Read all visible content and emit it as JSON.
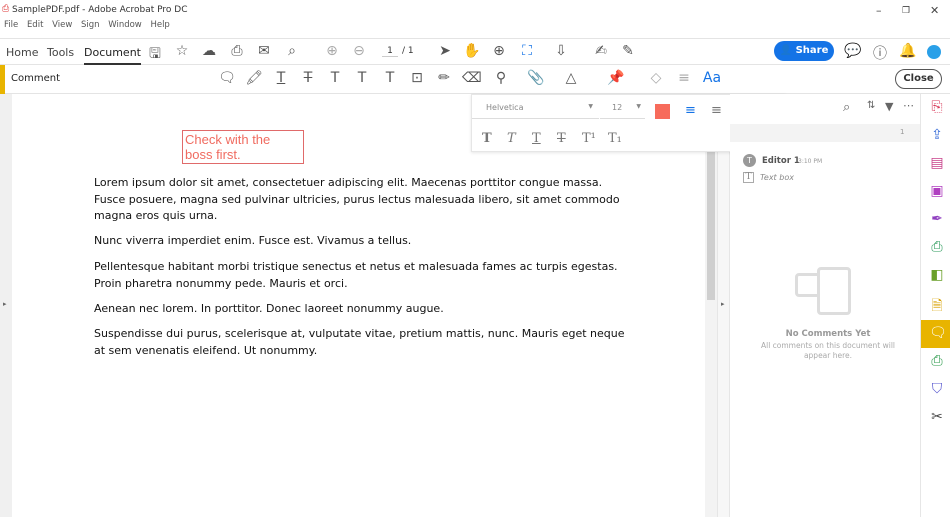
{
  "window": {
    "title": "SamplePDF.pdf - Adobe Acrobat Pro DC"
  },
  "menu": [
    "File",
    "Edit",
    "View",
    "Sign",
    "Window",
    "Help"
  ],
  "toolbar": {
    "tabs": [
      "Home",
      "Tools",
      "Document"
    ],
    "active_tab": "Document",
    "page_current": "1",
    "page_total": "/ 1",
    "share_label": "Share"
  },
  "comment_bar": {
    "label": "Comment",
    "close_label": "Close",
    "aa_label": "Aa"
  },
  "format_popup": {
    "font": "Helvetica",
    "size": "12",
    "color": "#f76b5b"
  },
  "document": {
    "textbox": "Check with the boss first.",
    "paragraphs": [
      "Lorem ipsum dolor sit amet, consectetuer adipiscing elit. Maecenas porttitor congue massa. Fusce posuere, magna sed pulvinar ultricies, purus lectus malesuada libero, sit amet commodo magna eros quis urna.",
      "Nunc viverra imperdiet enim. Fusce est. Vivamus a tellus.",
      "Pellentesque habitant morbi tristique senectus et netus et malesuada fames ac turpis egestas. Proin pharetra nonummy pede. Mauris et orci.",
      "Aenean nec lorem. In porttitor. Donec laoreet nonummy augue.",
      "Suspendisse dui purus, scelerisque at, vulputate vitae, pretium mattis, nunc. Mauris eget neque at sem venenatis eleifend. Ut nonummy."
    ]
  },
  "comments_pane": {
    "page_indicator": "1",
    "author": "Editor 1",
    "time": "3:10 PM",
    "type": "Text box",
    "empty_title": "No Comments Yet",
    "empty_text": "All comments on this document will appear here."
  },
  "colors": {
    "accent": "#1473e6",
    "comment_tool": "#e8b400",
    "text_color": "#f76b5b"
  }
}
